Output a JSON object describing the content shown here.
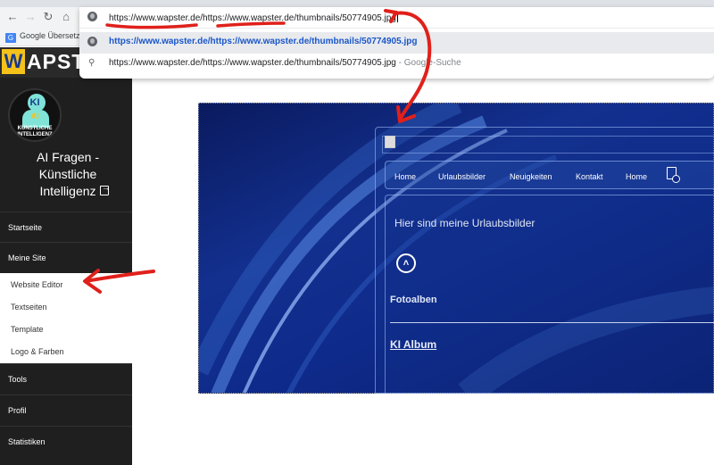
{
  "browser": {
    "bookmark_label": "Google Übersetz",
    "omnibox": {
      "typed_url": "https://www.wapster.de/https://www.wapster.de/thumbnails/50774905.jpg",
      "suggestion_1": "https://www.wapster.de/https://www.wapster.de/thumbnails/50774905.jpg",
      "suggestion_2_url": "https://www.wapster.de/https://www.wapster.de/thumbnails/50774905.jpg",
      "suggestion_2_suffix": " - Google-Suche"
    },
    "icons": [
      "back-arrow-icon",
      "forward-arrow-icon",
      "reload-icon",
      "home-icon",
      "globe-icon",
      "search-icon"
    ]
  },
  "site_logo": {
    "first_letter": "W",
    "rest": "APST"
  },
  "sidebar": {
    "avatar": {
      "ki": "KI",
      "ki2": "AI",
      "label": "KÜNSTLICHE INTELLIGENZ"
    },
    "site_name": "AI Fragen - Künstliche Intelligenz",
    "nav": [
      {
        "label": "Startseite"
      },
      {
        "label": "Meine Site"
      },
      {
        "label": "Tools"
      },
      {
        "label": "Profil"
      },
      {
        "label": "Statistiken"
      }
    ],
    "submenu": [
      {
        "label": "Website Editor"
      },
      {
        "label": "Textseiten"
      },
      {
        "label": "Template"
      },
      {
        "label": "Logo & Farben"
      }
    ]
  },
  "preview": {
    "menu": [
      "Home",
      "Urlaubsbilder",
      "Neuigkeiten",
      "Kontakt",
      "Home"
    ],
    "intro_text": "Hier sind meine Urlaubsbilder",
    "section_title": "Fotoalben",
    "album_link": "KI Album"
  },
  "colors": {
    "sidebar_bg": "#1f1f1f",
    "annotation_red": "#e0201b",
    "hero_blue": "#13308f",
    "logo_yellow": "#f4c21b"
  }
}
